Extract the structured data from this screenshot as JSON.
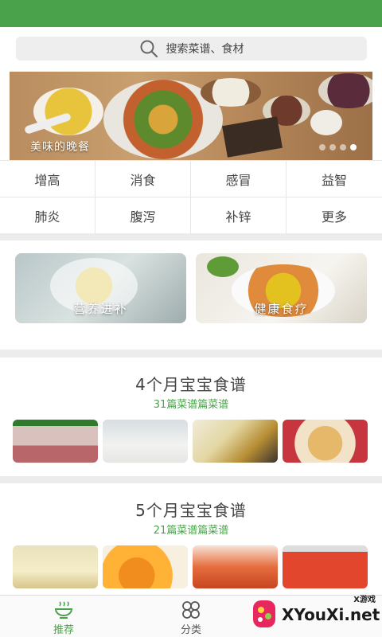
{
  "search": {
    "placeholder": "搜索菜谱、食材",
    "icon": "search-icon"
  },
  "banner": {
    "caption": "美味的晚餐",
    "slides": 4,
    "active_slide": 4
  },
  "tags": [
    "增高",
    "消食",
    "感冒",
    "益智",
    "肺炎",
    "腹泻",
    "补锌",
    "更多"
  ],
  "cards": [
    {
      "label": "营养进补"
    },
    {
      "label": "健康食疗"
    }
  ],
  "sections": [
    {
      "title": "4个月宝宝食谱",
      "count": "31篇菜谱篇菜谱"
    },
    {
      "title": "5个月宝宝食谱",
      "count": "21篇菜谱篇菜谱"
    }
  ],
  "tabbar": [
    {
      "label": "推荐",
      "icon": "bowl-icon",
      "active": true
    },
    {
      "label": "分类",
      "icon": "grid-clover-icon",
      "active": false
    }
  ],
  "watermark": {
    "small": "X游戏",
    "main": "XYouXi.net"
  },
  "colors": {
    "accent": "#4aa34a",
    "status_bar": "#4aa34a",
    "divider": "#ececec"
  }
}
